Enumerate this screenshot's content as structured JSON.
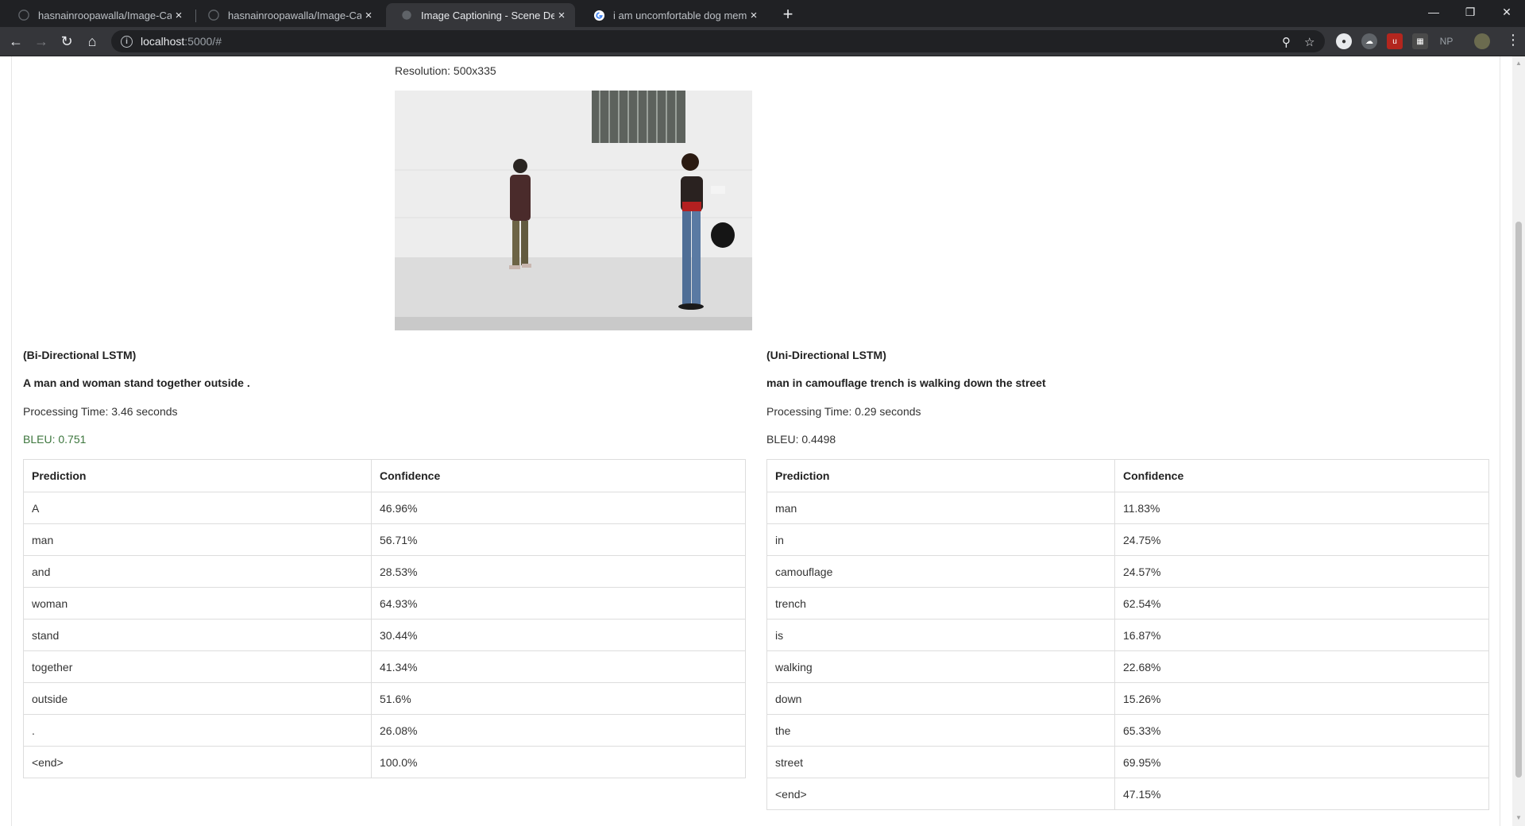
{
  "browser": {
    "tabs": [
      {
        "title": "hasnainroopawalla/Image-Captio",
        "icon": "github-icon",
        "active": false
      },
      {
        "title": "hasnainroopawalla/Image-Captio",
        "icon": "github-icon",
        "active": false
      },
      {
        "title": "Image Captioning - Scene Descri",
        "icon": "globe-icon",
        "active": true
      },
      {
        "title": "i am uncomfortable dog meme -",
        "icon": "google-icon",
        "active": false
      }
    ],
    "url_host": "localhost",
    "url_path": ":5000/#",
    "extensions": [
      "NP"
    ]
  },
  "page": {
    "resolution": "Resolution: 500x335"
  },
  "models": [
    {
      "title": "(Bi-Directional LSTM)",
      "caption": "A man and woman stand together outside .",
      "processing_time": "Processing Time: 3.46 seconds",
      "bleu": "BLEU: 0.751",
      "bleu_color": "#3c763d",
      "table": {
        "headers": [
          "Prediction",
          "Confidence"
        ],
        "rows": [
          [
            "A",
            "46.96%"
          ],
          [
            "man",
            "56.71%"
          ],
          [
            "and",
            "28.53%"
          ],
          [
            "woman",
            "64.93%"
          ],
          [
            "stand",
            "30.44%"
          ],
          [
            "together",
            "41.34%"
          ],
          [
            "outside",
            "51.6%"
          ],
          [
            ".",
            "26.08%"
          ],
          [
            "<end>",
            "100.0%"
          ]
        ]
      }
    },
    {
      "title": "(Uni-Directional LSTM)",
      "caption": "man in camouflage trench is walking down the street",
      "processing_time": "Processing Time: 0.29 seconds",
      "bleu": "BLEU: 0.4498",
      "bleu_color": "#333333",
      "table": {
        "headers": [
          "Prediction",
          "Confidence"
        ],
        "rows": [
          [
            "man",
            "11.83%"
          ],
          [
            "in",
            "24.75%"
          ],
          [
            "camouflage",
            "24.57%"
          ],
          [
            "trench",
            "62.54%"
          ],
          [
            "is",
            "16.87%"
          ],
          [
            "walking",
            "22.68%"
          ],
          [
            "down",
            "15.26%"
          ],
          [
            "the",
            "65.33%"
          ],
          [
            "street",
            "69.95%"
          ],
          [
            "<end>",
            "47.15%"
          ]
        ]
      }
    }
  ]
}
